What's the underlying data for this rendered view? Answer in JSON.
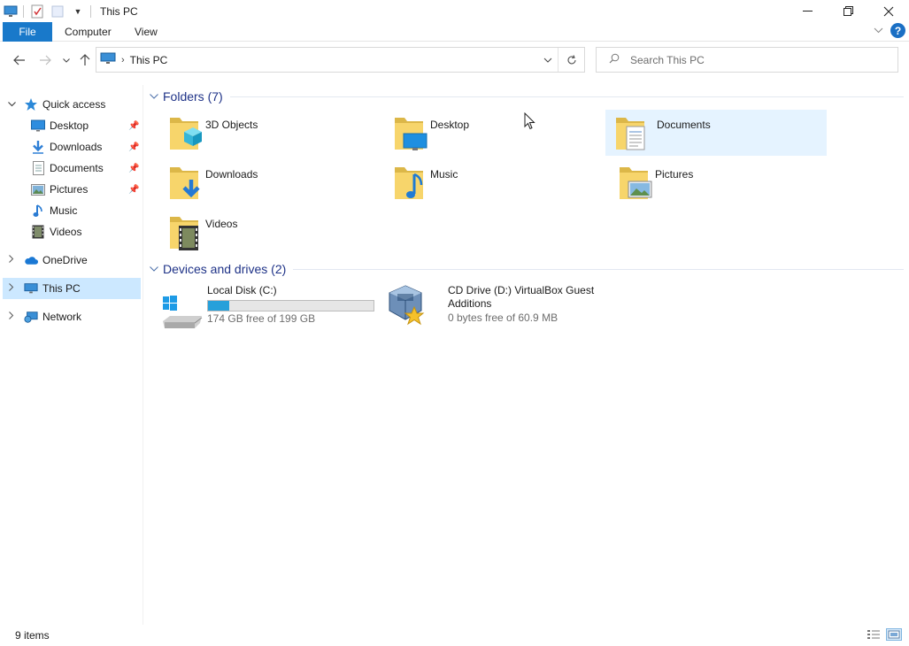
{
  "window": {
    "title": "This PC"
  },
  "ribbon": {
    "tabs": [
      "File",
      "Computer",
      "View"
    ]
  },
  "address": {
    "crumbs": [
      "This PC"
    ]
  },
  "search": {
    "placeholder": "Search This PC"
  },
  "nav": {
    "quick_access": "Quick access",
    "items": [
      {
        "label": "Desktop",
        "icon": "desktop-icon",
        "pinned": true
      },
      {
        "label": "Downloads",
        "icon": "downloads-icon",
        "pinned": true
      },
      {
        "label": "Documents",
        "icon": "documents-icon",
        "pinned": true
      },
      {
        "label": "Pictures",
        "icon": "pictures-icon",
        "pinned": true
      },
      {
        "label": "Music",
        "icon": "music-icon",
        "pinned": false
      },
      {
        "label": "Videos",
        "icon": "videos-icon",
        "pinned": false
      }
    ],
    "onedrive": "OneDrive",
    "this_pc": "This PC",
    "network": "Network"
  },
  "folders": {
    "header": "Folders (7)",
    "items": [
      {
        "label": "3D Objects",
        "icon": "3d-objects-folder-icon"
      },
      {
        "label": "Desktop",
        "icon": "desktop-folder-icon"
      },
      {
        "label": "Documents",
        "icon": "documents-folder-icon",
        "selected": true
      },
      {
        "label": "Downloads",
        "icon": "downloads-folder-icon"
      },
      {
        "label": "Music",
        "icon": "music-folder-icon"
      },
      {
        "label": "Pictures",
        "icon": "pictures-folder-icon"
      },
      {
        "label": "Videos",
        "icon": "videos-folder-icon"
      }
    ]
  },
  "drives": {
    "header": "Devices and drives (2)",
    "items": [
      {
        "name": "Local Disk (C:)",
        "free": "174 GB free of 199 GB",
        "used_fraction": 0.126,
        "icon": "windows-drive-icon"
      },
      {
        "name": "CD Drive (D:) VirtualBox Guest Additions",
        "free": "0 bytes free of 60.9 MB",
        "icon": "virtualbox-cd-icon"
      }
    ]
  },
  "status": {
    "count": "9 items"
  },
  "colors": {
    "accent": "#1979ca",
    "selection": "#cce8ff",
    "hover": "#e5f3ff",
    "group_title": "#1e3287",
    "drive_fill": "#26a0da"
  }
}
